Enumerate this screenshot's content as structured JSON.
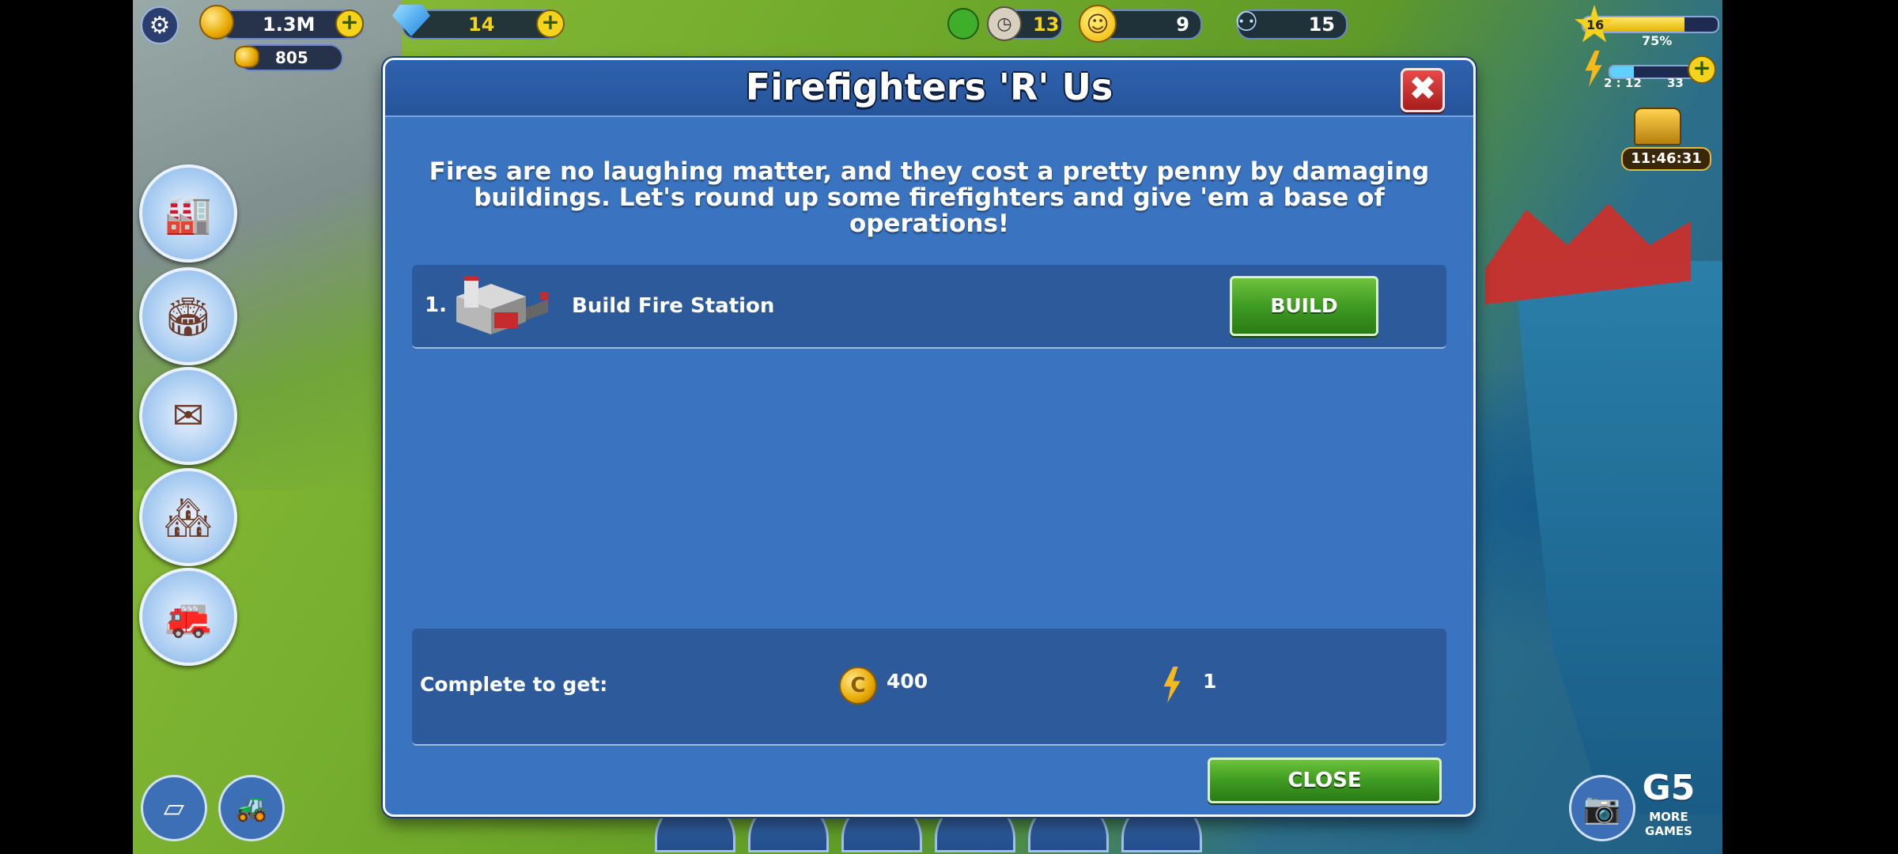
{
  "hud": {
    "coins": "1.3M",
    "diamonds": "14",
    "secondary_coins": "805",
    "timer_count": "13",
    "happiness": "9",
    "population": "15",
    "level": "16",
    "xp_percent": "75%",
    "xp_fraction": 0.75,
    "energy_timer": "2 : 12",
    "energy": "33",
    "chest_timer": "11:46:31"
  },
  "dialog": {
    "title": "Firefighters 'R' Us",
    "description": "Fires are no laughing matter, and they cost a pretty penny by damaging buildings. Let's round up some firefighters and give 'em a base of operations!",
    "tasks": [
      {
        "number": "1.",
        "label": "Build Fire Station",
        "button": "BUILD"
      }
    ],
    "reward_label": "Complete to get:",
    "reward_coins": "400",
    "reward_energy": "1",
    "close_label": "CLOSE"
  },
  "branding": {
    "logo": "G5",
    "more_games": "MORE GAMES"
  },
  "colors": {
    "dialog_bg": "#3a73bf",
    "row_bg": "#2d5a9a",
    "green_button": "#3f9b22",
    "close_red": "#c62b2b"
  },
  "icons": [
    "gear-icon",
    "coins-icon",
    "diamond-icon",
    "tree-icon",
    "clock-icon",
    "smiley-icon",
    "people-icon",
    "star-icon",
    "lightning-icon",
    "chest-icon",
    "camera-icon",
    "close-icon",
    "coin-icon"
  ]
}
